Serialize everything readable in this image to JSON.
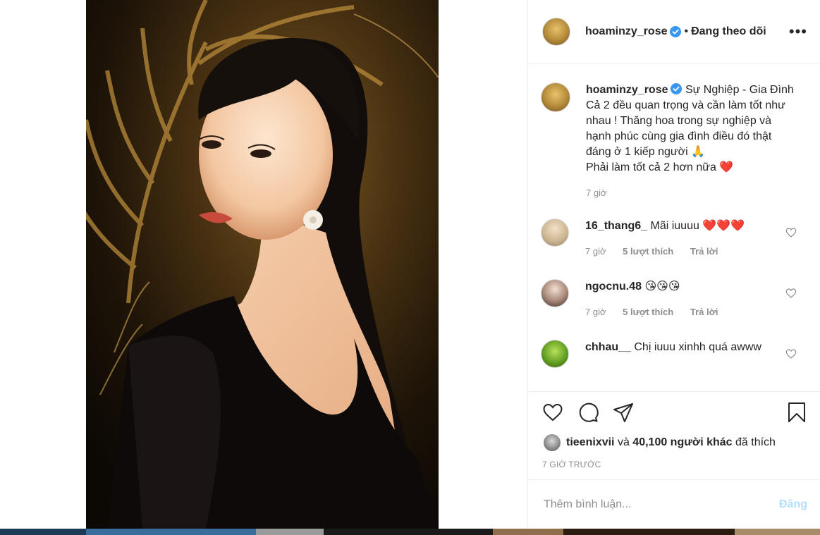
{
  "post": {
    "username": "hoaminzy_rose",
    "follow_status": "Đang theo dõi",
    "dot": "•",
    "more_icon": "more-horizontal-icon",
    "caption_lines": [
      "Sự Nghiệp - Gia Đình",
      "Cả 2 đều quan trọng và cần làm tốt như nhau ! Thăng hoa trong sự nghiệp và hạnh phúc cùng gia đình điều đó thật đáng ở 1 kiếp người 🙏",
      "Phải làm tốt cả 2 hơn nữa ❤️"
    ],
    "caption_time": "7 giờ"
  },
  "comments": [
    {
      "username": "16_thang6_",
      "text": "Mãi iuuuu ❤️❤️❤️",
      "time": "7 giờ",
      "likes": "5 lượt thích",
      "reply": "Trả lời"
    },
    {
      "username": "ngocnu.48",
      "text": "😘😘😘",
      "time": "7 giờ",
      "likes": "5 lượt thích",
      "reply": "Trả lời"
    },
    {
      "username": "chhau__",
      "text": "Chị iuuu xinhh quá awww"
    }
  ],
  "likes": {
    "first_user": "tieenixvii",
    "connector": "và",
    "others": "40,100 người khác",
    "suffix": "đã thích"
  },
  "time_ago": "7 GIỜ TRƯỚC",
  "add_comment": {
    "placeholder": "Thêm bình luận...",
    "post_label": "Đăng"
  },
  "colors": {
    "verified": "#3897f0",
    "post_disabled": "#b2dffc",
    "muted": "#8e8e8e",
    "heart_emoji": "#ed1c24"
  }
}
